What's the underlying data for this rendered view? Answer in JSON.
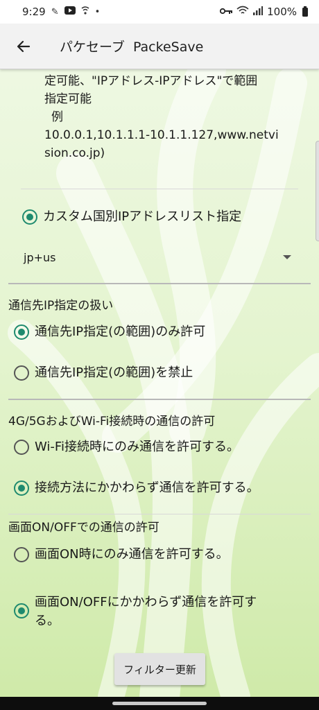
{
  "status_bar": {
    "time": "9:29",
    "battery": "100%",
    "icons": [
      "notification-icon",
      "youtube-icon",
      "wifi-call-icon",
      "dot-icon",
      "vpn-key-icon",
      "wifi-icon",
      "signal-icon",
      "battery-icon"
    ]
  },
  "app_bar": {
    "title": "パケセーブ  PackeSave",
    "back_icon": "arrow-back-icon"
  },
  "description": {
    "line1": "定可能、\"IPアドレス-IPアドレス\"で範囲",
    "line2": "指定可能",
    "line3": "例",
    "line4": "10.0.0.1,10.1.1.1-10.1.1.127,www.netvi",
    "line5": "sion.co.jp)"
  },
  "custom_country": {
    "label": "カスタム国別IPアドレスリスト指定",
    "selected": true,
    "spinner_value": "jp+us"
  },
  "destination_ip": {
    "title": "通信先IP指定の扱い",
    "options": [
      {
        "label": "通信先IP指定(の範囲)のみ許可",
        "selected": true
      },
      {
        "label": "通信先IP指定(の範囲)を禁止",
        "selected": false
      }
    ]
  },
  "connection_type": {
    "title": "4G/5GおよびWi-Fi接続時の通信の許可",
    "options": [
      {
        "label": "Wi-Fi接続時にのみ通信を許可する。",
        "selected": false
      },
      {
        "label": "接続方法にかかわらず通信を許可する。",
        "selected": true
      }
    ]
  },
  "screen_state": {
    "title": "画面ON/OFFでの通信の許可",
    "options": [
      {
        "label": "画面ON時にのみ通信を許可する。",
        "selected": false
      },
      {
        "label_line1": "画面ON/OFFにかかわらず通信を許可す",
        "label_line2": "る。",
        "selected": true
      }
    ]
  },
  "filter_button": {
    "label": "フィルター更新"
  },
  "colors": {
    "accent": "#1e8a6e",
    "background_top": "#eef8e2",
    "background_bottom": "#cfeaa9"
  }
}
